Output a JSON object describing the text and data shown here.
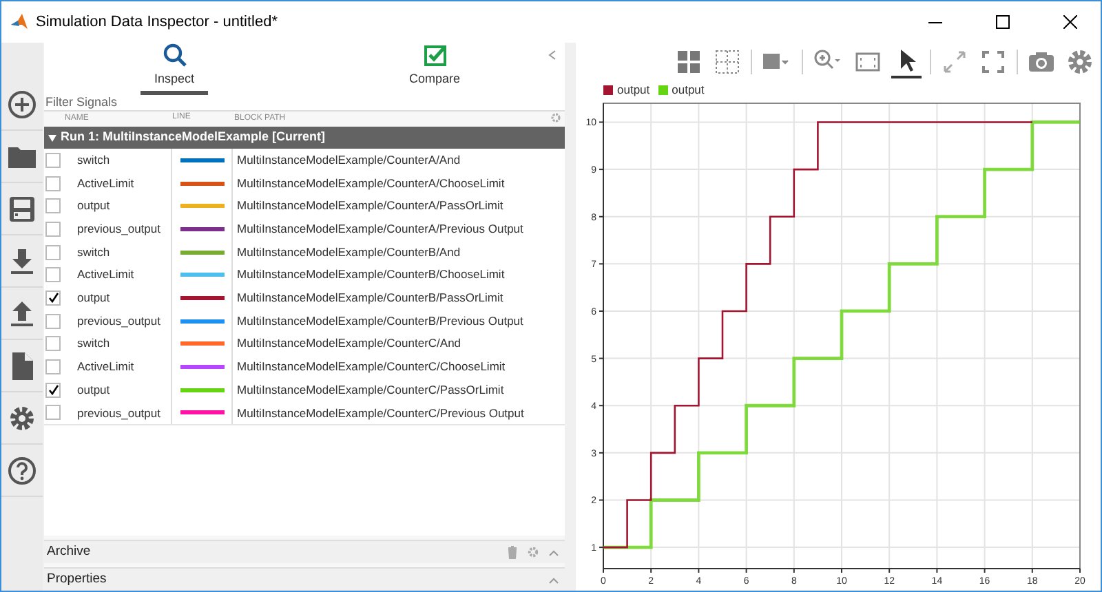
{
  "window": {
    "title": "Simulation Data Inspector - untitled*"
  },
  "sidebar": {
    "items": [
      {
        "kind": "add"
      },
      {
        "kind": "open"
      },
      {
        "kind": "save"
      },
      {
        "kind": "import"
      },
      {
        "kind": "export"
      },
      {
        "kind": "report"
      },
      {
        "kind": "settings"
      },
      {
        "kind": "help"
      }
    ]
  },
  "tabs": [
    {
      "label": "Inspect",
      "kind": "inspect",
      "selected": true
    },
    {
      "label": "Compare",
      "kind": "compare",
      "selected": false
    }
  ],
  "filter": {
    "placeholder": "Filter Signals"
  },
  "columns": [
    "NAME",
    "LINE",
    "BLOCK PATH"
  ],
  "run": {
    "label": "Run 1: MultiInstanceModelExample [Current]",
    "expanded": true
  },
  "signals": [
    {
      "name": "switch",
      "color": "#0072bd",
      "path": "MultiInstanceModelExample/CounterA/And",
      "checked": false
    },
    {
      "name": "ActiveLimit",
      "color": "#d95319",
      "path": "MultiInstanceModelExample/CounterA/ChooseLimit",
      "checked": false
    },
    {
      "name": "output",
      "color": "#edb120",
      "path": "MultiInstanceModelExample/CounterA/PassOrLimit",
      "checked": false
    },
    {
      "name": "previous_output",
      "color": "#7e2f8e",
      "path": "MultiInstanceModelExample/CounterA/Previous Output",
      "checked": false
    },
    {
      "name": "switch",
      "color": "#77ac30",
      "path": "MultiInstanceModelExample/CounterB/And",
      "checked": false
    },
    {
      "name": "ActiveLimit",
      "color": "#4dbeee",
      "path": "MultiInstanceModelExample/CounterB/ChooseLimit",
      "checked": false
    },
    {
      "name": "output",
      "color": "#a2142f",
      "path": "MultiInstanceModelExample/CounterB/PassOrLimit",
      "checked": true
    },
    {
      "name": "previous_output",
      "color": "#1e90f0",
      "path": "MultiInstanceModelExample/CounterB/Previous Output",
      "checked": false
    },
    {
      "name": "switch",
      "color": "#ff6929",
      "path": "MultiInstanceModelExample/CounterC/And",
      "checked": false
    },
    {
      "name": "ActiveLimit",
      "color": "#b746ff",
      "path": "MultiInstanceModelExample/CounterC/ChooseLimit",
      "checked": false
    },
    {
      "name": "output",
      "color": "#64d413",
      "path": "MultiInstanceModelExample/CounterC/PassOrLimit",
      "checked": true
    },
    {
      "name": "previous_output",
      "color": "#ff13a6",
      "path": "MultiInstanceModelExample/CounterC/Previous Output",
      "checked": false
    }
  ],
  "sections": [
    {
      "label": "Archive",
      "kind": "archive"
    },
    {
      "label": "Properties",
      "kind": "properties"
    }
  ],
  "toolbar": [
    {
      "kind": "layout",
      "selected": false
    },
    {
      "kind": "subplots",
      "selected": false
    },
    {
      "kind": "sep"
    },
    {
      "kind": "visual",
      "selected": false
    },
    {
      "kind": "sep"
    },
    {
      "kind": "zoom",
      "selected": false
    },
    {
      "kind": "fit",
      "selected": false
    },
    {
      "kind": "cursor",
      "selected": true
    },
    {
      "kind": "sep"
    },
    {
      "kind": "expand",
      "selected": false
    },
    {
      "kind": "fullscreen",
      "selected": false
    },
    {
      "kind": "sep"
    },
    {
      "kind": "snapshot",
      "selected": false
    },
    {
      "kind": "settings",
      "selected": false
    }
  ],
  "chart_data": {
    "type": "line",
    "grid": true,
    "x": [
      0,
      1,
      1,
      2,
      2,
      3,
      3,
      4,
      4,
      5,
      5,
      6,
      6,
      7,
      7,
      8,
      8,
      9,
      9,
      10,
      10,
      11,
      11,
      12,
      12,
      13,
      13,
      14,
      14,
      15,
      15,
      16,
      16,
      17,
      17,
      18,
      18,
      19,
      19,
      20
    ],
    "series": [
      {
        "name": "output",
        "color": "#a2142f",
        "values": [
          1,
          1,
          2,
          2,
          3,
          3,
          4,
          4,
          5,
          5,
          6,
          6,
          7,
          7,
          8,
          8,
          9,
          9,
          10,
          10,
          10,
          10,
          10,
          10,
          10,
          10,
          10,
          10,
          10,
          10,
          10,
          10,
          10,
          10,
          10,
          10,
          null,
          null,
          null,
          null
        ]
      },
      {
        "name": "output",
        "color": "#64d413",
        "values": [
          1,
          1,
          1,
          1,
          2,
          2,
          2,
          2,
          3,
          3,
          3,
          3,
          4,
          4,
          4,
          4,
          5,
          5,
          5,
          5,
          6,
          6,
          6,
          6,
          7,
          7,
          7,
          7,
          8,
          8,
          8,
          8,
          9,
          9,
          9,
          9,
          10,
          10,
          10,
          10
        ]
      }
    ],
    "xlim": [
      0,
      20
    ],
    "ylim": [
      0.55,
      10.4
    ],
    "xticks": [
      0,
      2,
      4,
      6,
      8,
      10,
      12,
      14,
      16,
      18,
      20
    ],
    "yticks": [
      1,
      2,
      3,
      4,
      5,
      6,
      7,
      8,
      9,
      10
    ]
  }
}
